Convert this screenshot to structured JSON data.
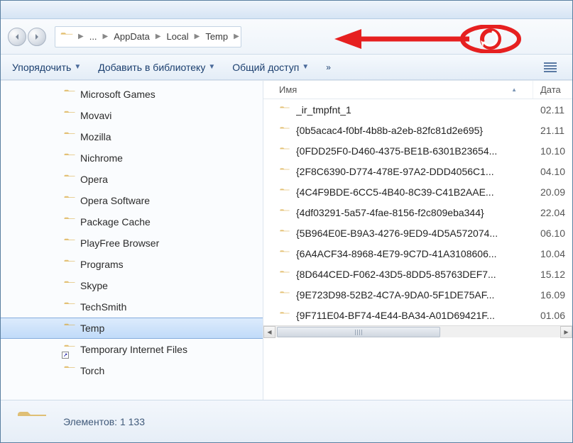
{
  "breadcrumb": {
    "segments": [
      "...",
      "AppData",
      "Local",
      "Temp"
    ]
  },
  "toolbar": {
    "organize": "Упорядочить",
    "add_library": "Добавить в библиотеку",
    "share": "Общий доступ",
    "overflow": "»"
  },
  "sidebar": {
    "items": [
      {
        "label": "Microsoft Games",
        "type": "folder"
      },
      {
        "label": "Movavi",
        "type": "folder"
      },
      {
        "label": "Mozilla",
        "type": "folder"
      },
      {
        "label": "Nichrome",
        "type": "folder"
      },
      {
        "label": "Opera",
        "type": "folder"
      },
      {
        "label": "Opera Software",
        "type": "folder"
      },
      {
        "label": "Package Cache",
        "type": "folder"
      },
      {
        "label": "PlayFree Browser",
        "type": "folder"
      },
      {
        "label": "Programs",
        "type": "folder"
      },
      {
        "label": "Skype",
        "type": "folder"
      },
      {
        "label": "TechSmith",
        "type": "folder"
      },
      {
        "label": "Temp",
        "type": "folder",
        "selected": true
      },
      {
        "label": "Temporary Internet Files",
        "type": "shortcut"
      },
      {
        "label": "Torch",
        "type": "folder"
      }
    ]
  },
  "columns": {
    "name": "Имя",
    "date": "Дата"
  },
  "files": [
    {
      "name": "_ir_tmpfnt_1",
      "date": "02.11"
    },
    {
      "name": "{0b5acac4-f0bf-4b8b-a2eb-82fc81d2e695}",
      "date": "21.11"
    },
    {
      "name": "{0FDD25F0-D460-4375-BE1B-6301B23654...",
      "date": "10.10"
    },
    {
      "name": "{2F8C6390-D774-478E-97A2-DDD4056C1...",
      "date": "04.10"
    },
    {
      "name": "{4C4F9BDE-6CC5-4B40-8C39-C41B2AAE...",
      "date": "20.09"
    },
    {
      "name": "{4df03291-5a57-4fae-8156-f2c809eba344}",
      "date": "22.04"
    },
    {
      "name": "{5B964E0E-B9A3-4276-9ED9-4D5A572074...",
      "date": "06.10"
    },
    {
      "name": "{6A4ACF34-8968-4E79-9C7D-41A3108606...",
      "date": "10.04"
    },
    {
      "name": "{8D644CED-F062-43D5-8DD5-85763DEF7...",
      "date": "15.12"
    },
    {
      "name": "{9E723D98-52B2-4C7A-9DA0-5F1DE75AF...",
      "date": "16.09"
    },
    {
      "name": "{9F711E04-BF74-4E44-BA34-A01D69421F...",
      "date": "01.06"
    }
  ],
  "status": {
    "elements_label": "Элементов:",
    "elements_count": "1 133"
  },
  "colors": {
    "folder_light": "#fde9a7",
    "folder_dark": "#e9b84f",
    "red_accent": "#e62020"
  }
}
